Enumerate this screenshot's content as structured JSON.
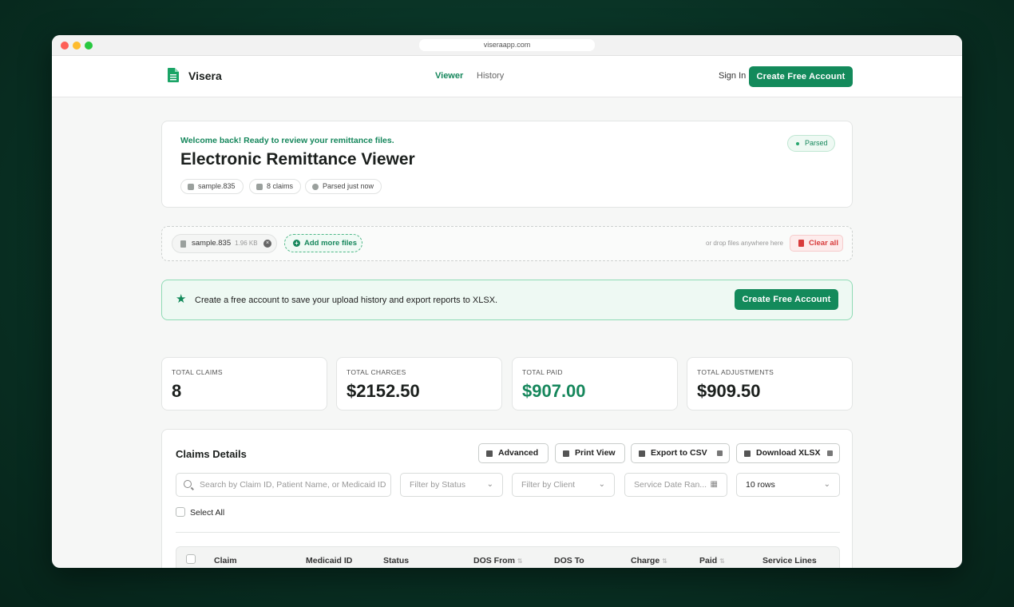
{
  "browser": {
    "url": "viseraapp.com"
  },
  "nav": {
    "brand": "Visera",
    "links": [
      "Viewer",
      "History"
    ],
    "signin": "Sign In",
    "cta": "Create Free Account"
  },
  "hero": {
    "welcome": "Welcome back! Ready to review your remittance files.",
    "title": "Electronic Remittance Viewer",
    "chips": [
      "sample.835",
      "8 claims",
      "Parsed just now"
    ],
    "badge": "Parsed"
  },
  "upload": {
    "file_name": "sample.835",
    "file_size": "1.96 KB",
    "add_more": "Add more files",
    "hint": "or drop files anywhere here",
    "clear": "Clear all"
  },
  "banner": {
    "text": "Create a free account to save your upload history and export reports to XLSX.",
    "cta": "Create Free Account"
  },
  "stats": [
    {
      "label": "TOTAL CLAIMS",
      "value": "8"
    },
    {
      "label": "TOTAL CHARGES",
      "value": "$2152.50"
    },
    {
      "label": "TOTAL PAID",
      "value": "$907.00"
    },
    {
      "label": "TOTAL ADJUSTMENTS",
      "value": "$909.50"
    }
  ],
  "claims": {
    "title": "Claims Details",
    "buttons": [
      "Advanced",
      "Print View",
      "Export to CSV",
      "Download XLSX"
    ],
    "search_placeholder": "Search by Claim ID, Patient Name, or Medicaid ID",
    "filter_status": "Filter by Status",
    "filter_client": "Filter by Client",
    "date_range": "Service Date Ran...",
    "rows": "10 rows",
    "select_all": "Select All",
    "columns": [
      "Claim",
      "Medicaid ID",
      "Status",
      "DOS From",
      "DOS To",
      "Charge",
      "Paid",
      "Service Lines"
    ]
  },
  "colors": {
    "accent": "#138a5b",
    "accent_light": "#eef9f3",
    "danger": "#d83b3b"
  }
}
